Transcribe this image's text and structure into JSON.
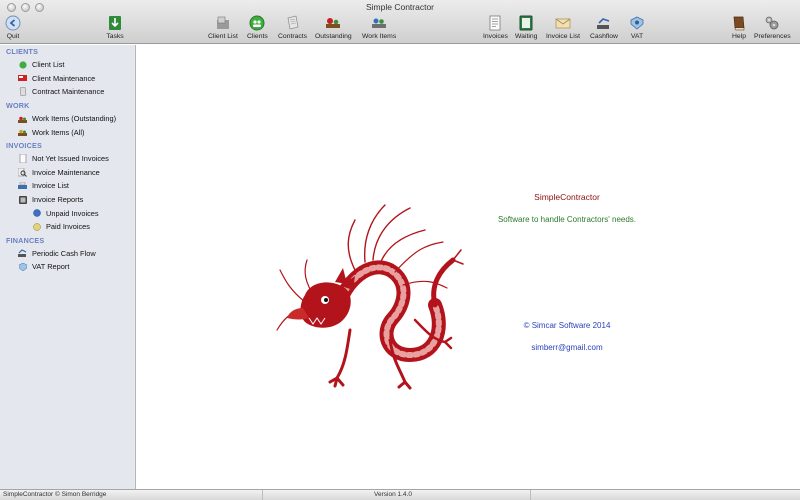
{
  "window": {
    "title": "Simple Contractor"
  },
  "toolbar": {
    "quit": "Quit",
    "tasks": "Tasks",
    "client_list": "Client List",
    "clients": "Clients",
    "contracts": "Contracts",
    "outstanding": "Outstanding",
    "work_items": "Work Items",
    "invoices": "Invoices",
    "waiting": "Waiting",
    "invoice_list": "Invoice List",
    "cashflow": "Cashflow",
    "vat": "VAT",
    "help": "Help",
    "preferences": "Preferences"
  },
  "sidebar": {
    "clients": {
      "header": "CLIENTS",
      "items": [
        "Client List",
        "Client Maintenance",
        "Contract Maintenance"
      ]
    },
    "work": {
      "header": "WORK",
      "items": [
        "Work Items (Outstanding)",
        "Work Items (All)"
      ]
    },
    "invoices": {
      "header": "INVOICES",
      "items": [
        "Not Yet Issued Invoices",
        "Invoice Maintenance",
        "Invoice List",
        "Invoice Reports"
      ],
      "sub_items": [
        "Unpaid Invoices",
        "Paid Invoices"
      ]
    },
    "finances": {
      "header": "FINANCES",
      "items": [
        "Periodic Cash Flow",
        "VAT Report"
      ]
    }
  },
  "main": {
    "app_name": "SimpleContractor",
    "tagline": "Software to handle Contractors' needs.",
    "copyright": "© Simcar Software 2014",
    "email": "simberr@gmail.com"
  },
  "statusbar": {
    "left": "SimpleContractor © Simon Berridge",
    "version": "Version 1.4.0"
  },
  "colors": {
    "section_header": "#6a7fc2",
    "app_name": "#8b0f0f",
    "tagline": "#2b7a2b",
    "link_blue": "#2a3fb8",
    "dragon_red": "#b3141c"
  }
}
